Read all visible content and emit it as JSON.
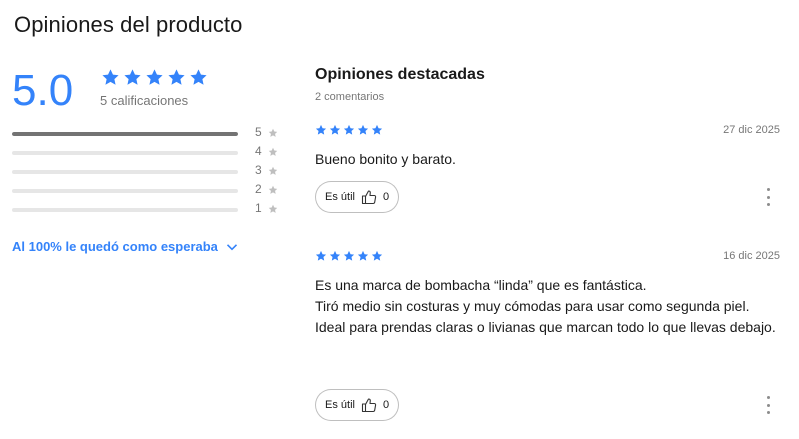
{
  "page": {
    "title": "Opiniones del producto"
  },
  "summary": {
    "average": "5.0",
    "average_stars": 5,
    "rating_count_text": "5 calificaciones",
    "distribution": [
      {
        "label": "5",
        "fraction": 1.0
      },
      {
        "label": "4",
        "fraction": 0.0
      },
      {
        "label": "3",
        "fraction": 0.0
      },
      {
        "label": "2",
        "fraction": 0.0
      },
      {
        "label": "1",
        "fraction": 0.0
      }
    ],
    "expectation_text": "Al 100% le quedó como esperaba",
    "expectation_icon": "chevron-down-icon"
  },
  "reviews_section": {
    "title": "Opiniones destacadas",
    "count_text": "2 comentarios",
    "reviews": [
      {
        "stars": 5,
        "date": "27 dic 2025",
        "text": "Bueno bonito y barato.",
        "useful_label": "Es útil",
        "useful_count": "0"
      },
      {
        "stars": 5,
        "date": "16 dic 2025",
        "text": "Es una marca de bombacha “linda” que es fantástica.\nTiró medio sin costuras y muy cómodas para usar como segunda piel. Ideal para prendas claras o livianas que marcan todo lo que llevas debajo.",
        "useful_label": "Es útil",
        "useful_count": "0"
      }
    ]
  },
  "colors": {
    "accent": "#3483fa",
    "bar_fill": "#737373",
    "bar_track": "#e6e6e6",
    "muted_star": "#bfbfbf"
  }
}
